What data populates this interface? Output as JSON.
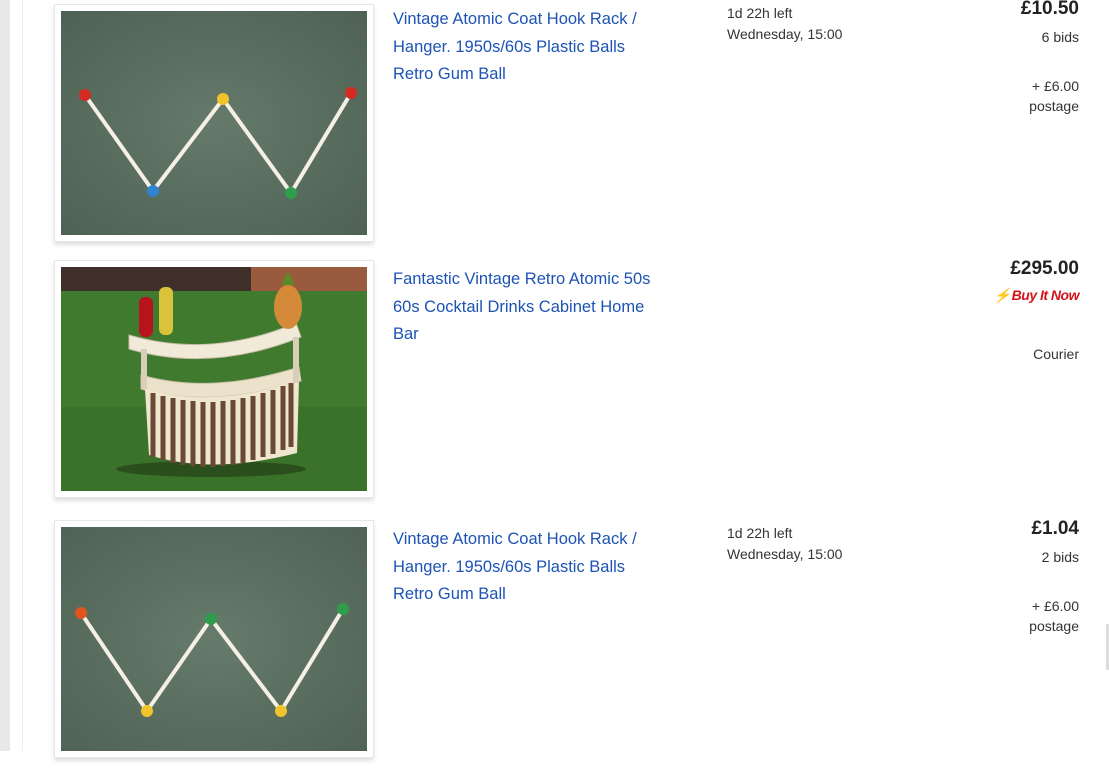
{
  "listings": [
    {
      "title_line1": "Vintage Atomic Coat Hook Rack /",
      "title_line2": "Hanger. 1950s/60s Plastic Balls",
      "title_line3": "Retro Gum Ball",
      "time_left": "1d 22h left",
      "end_time": "Wednesday, 15:00",
      "price": "£10.50",
      "bids": "6 bids",
      "postage_amount": "+ £6.00",
      "postage_label": "postage",
      "image_icon": "coat-hook-rack-photo"
    },
    {
      "title_line1": "Fantastic Vintage Retro Atomic 50s",
      "title_line2": "60s Cocktail Drinks Cabinet Home",
      "title_line3": "Bar",
      "price": "£295.00",
      "buy_it_now": "Buy It Now",
      "delivery": "Courier",
      "image_icon": "cocktail-bar-photo"
    },
    {
      "title_line1": "Vintage Atomic Coat Hook Rack /",
      "title_line2": "Hanger. 1950s/60s Plastic Balls",
      "title_line3": "Retro Gum Ball",
      "time_left": "1d 22h left",
      "end_time": "Wednesday, 15:00",
      "price": "£1.04",
      "bids": "2 bids",
      "postage_amount": "+ £6.00",
      "postage_label": "postage",
      "image_icon": "coat-hook-rack-photo"
    }
  ],
  "colors": {
    "link": "#1d53b4",
    "buy_it_now": "#d5131a",
    "text": "#333333"
  }
}
